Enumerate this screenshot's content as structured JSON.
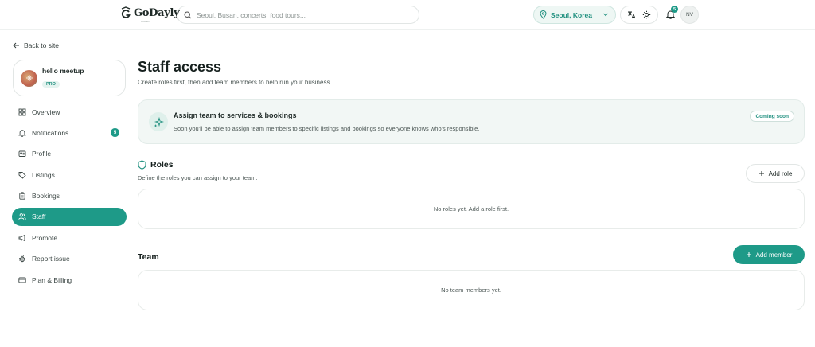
{
  "header": {
    "logo_text": "GoDayly",
    "logo_subtext": "KOREA",
    "search_placeholder": "Seoul, Busan, concerts, food tours...",
    "location": "Seoul, Korea",
    "notification_count": "5",
    "user_initials": "NV"
  },
  "sidebar": {
    "back_label": "Back to site",
    "profile": {
      "name": "hello meetup",
      "badge": "PRO"
    },
    "items": [
      {
        "label": "Overview",
        "icon": "grid-icon"
      },
      {
        "label": "Notifications",
        "icon": "bell-icon",
        "count": "5"
      },
      {
        "label": "Profile",
        "icon": "id-card-icon"
      },
      {
        "label": "Listings",
        "icon": "tag-icon"
      },
      {
        "label": "Bookings",
        "icon": "clipboard-icon"
      },
      {
        "label": "Staff",
        "icon": "users-icon",
        "active": true
      },
      {
        "label": "Promote",
        "icon": "megaphone-icon"
      },
      {
        "label": "Report issue",
        "icon": "bug-icon"
      },
      {
        "label": "Plan & Billing",
        "icon": "credit-card-icon"
      }
    ]
  },
  "main": {
    "title": "Staff access",
    "subtitle": "Create roles first, then add team members to help run your business.",
    "banner": {
      "title": "Assign team to services & bookings",
      "text": "Soon you'll be able to assign team members to specific listings and bookings so everyone knows who's responsible.",
      "badge": "Coming soon"
    },
    "roles": {
      "title": "Roles",
      "subtitle": "Define the roles you can assign to your team.",
      "add_label": "Add role",
      "empty": "No roles yet. Add a role first."
    },
    "team": {
      "title": "Team",
      "add_label": "Add member",
      "empty": "No team members yet."
    }
  },
  "colors": {
    "accent": "#1e9a88",
    "banner_bg": "#f2f7f5"
  }
}
